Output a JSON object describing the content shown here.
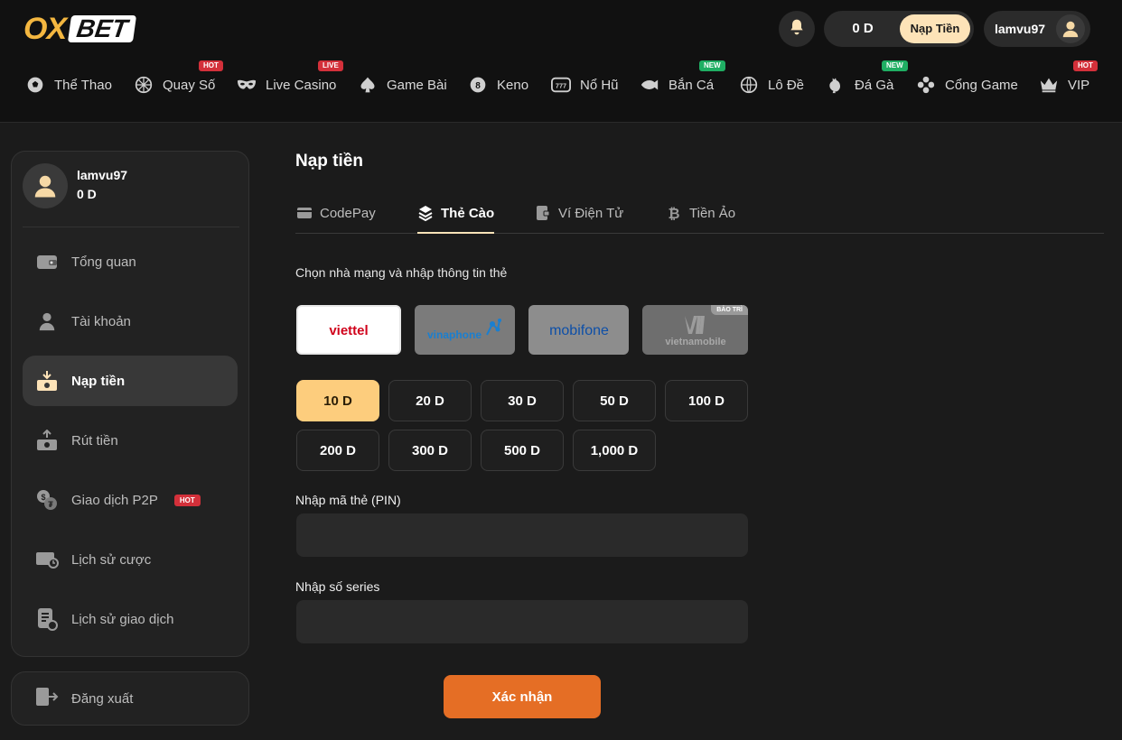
{
  "brand": {
    "logo_left": "OX",
    "logo_right": "BET"
  },
  "header": {
    "balance": "0 D",
    "deposit_button": "Nạp Tiền",
    "username": "lamvu97"
  },
  "nav": [
    {
      "label": "Thể Thao",
      "icon": "soccer-ball-icon",
      "badge": ""
    },
    {
      "label": "Quay Số",
      "icon": "lottery-ball-icon",
      "badge": "HOT"
    },
    {
      "label": "Live Casino",
      "icon": "mask-icon",
      "badge": "LIVE"
    },
    {
      "label": "Game Bài",
      "icon": "spade-icon",
      "badge": ""
    },
    {
      "label": "Keno",
      "icon": "keno-8-icon",
      "badge": ""
    },
    {
      "label": "Nổ Hũ",
      "icon": "slot-777-icon",
      "badge": ""
    },
    {
      "label": "Bắn Cá",
      "icon": "fish-icon",
      "badge": "NEW"
    },
    {
      "label": "Lô Đề",
      "icon": "globe-bet-icon",
      "badge": ""
    },
    {
      "label": "Đá Gà",
      "icon": "rooster-icon",
      "badge": "NEW"
    },
    {
      "label": "Cổng Game",
      "icon": "gamepad-icon",
      "badge": ""
    },
    {
      "label": "VIP",
      "icon": "crown-icon",
      "badge": "HOT"
    }
  ],
  "sidebar": {
    "username": "lamvu97",
    "balance": "0 D",
    "items": [
      {
        "label": "Tổng quan",
        "icon": "wallet-icon",
        "active": false,
        "tag": ""
      },
      {
        "label": "Tài khoản",
        "icon": "user-icon",
        "active": false,
        "tag": ""
      },
      {
        "label": "Nạp tiền",
        "icon": "deposit-icon",
        "active": true,
        "tag": ""
      },
      {
        "label": "Rút tiền",
        "icon": "withdraw-icon",
        "active": false,
        "tag": ""
      },
      {
        "label": "Giao dịch P2P",
        "icon": "p2p-exchange-icon",
        "active": false,
        "tag": "HOT"
      },
      {
        "label": "Lịch sử cược",
        "icon": "bet-history-icon",
        "active": false,
        "tag": ""
      },
      {
        "label": "Lịch sử giao dịch",
        "icon": "transaction-history-icon",
        "active": false,
        "tag": ""
      }
    ],
    "logout": "Đăng xuất"
  },
  "main": {
    "title": "Nạp tiền",
    "tabs": [
      {
        "label": "CodePay",
        "icon": "card-icon",
        "active": false
      },
      {
        "label": "Thẻ Cào",
        "icon": "layers-icon",
        "active": true
      },
      {
        "label": "Ví Điện Tử",
        "icon": "e-wallet-icon",
        "active": false
      },
      {
        "label": "Tiền Ảo",
        "icon": "bitcoin-icon",
        "active": false
      }
    ],
    "instruction": "Chọn nhà mạng và nhập thông tin thẻ",
    "carriers": [
      {
        "name": "viettel",
        "selected": true,
        "maintenance": ""
      },
      {
        "name": "vinaphone",
        "selected": false,
        "maintenance": ""
      },
      {
        "name": "mobifone",
        "selected": false,
        "maintenance": ""
      },
      {
        "name": "vietnamobile",
        "selected": false,
        "maintenance": "BẢO TRÌ"
      }
    ],
    "amounts": [
      "10 D",
      "20 D",
      "30 D",
      "50 D",
      "100 D",
      "200 D",
      "300 D",
      "500 D",
      "1,000 D"
    ],
    "selected_amount": "10 D",
    "pin_label": "Nhập mã thẻ (PIN)",
    "pin_value": "",
    "serial_label": "Nhập số series",
    "serial_value": "",
    "submit": "Xác nhận"
  },
  "colors": {
    "accent": "#fdcd7d",
    "deposit_pill": "#fde3b8",
    "submit": "#e56e25",
    "logo": "#f4b740",
    "hot": "#d3303a",
    "new": "#1fae63"
  }
}
